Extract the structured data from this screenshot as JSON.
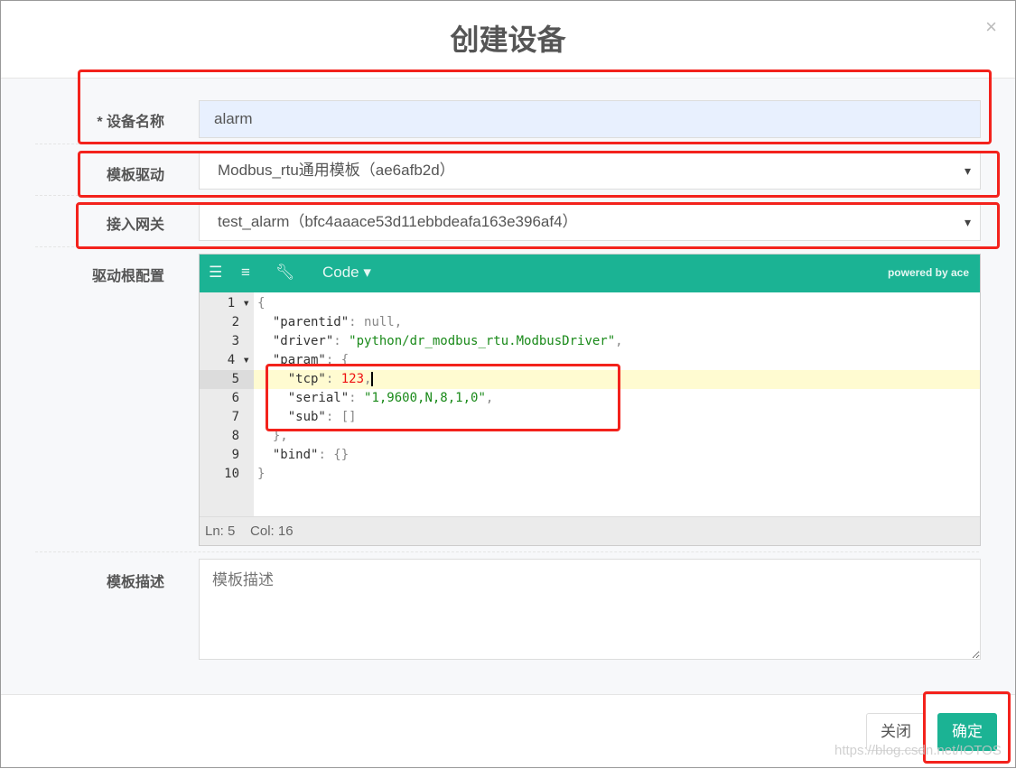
{
  "dialog": {
    "title": "创建设备",
    "close_icon": "×"
  },
  "form": {
    "name": {
      "label": "* 设备名称",
      "value": "alarm"
    },
    "template": {
      "label": "模板驱动",
      "value": "Modbus_rtu通用模板（ae6afb2d）"
    },
    "gateway": {
      "label": "接入网关",
      "value": "test_alarm（bfc4aaace53d11ebbdeafa163e396af4）"
    },
    "config": {
      "label": "驱动根配置"
    },
    "description": {
      "label": "模板描述",
      "placeholder": "模板描述"
    }
  },
  "editor": {
    "mode": "Code",
    "powered": "powered by ace",
    "status": {
      "line": "Ln: 5",
      "col": "Col: 16"
    },
    "line_numbers": [
      "1",
      "2",
      "3",
      "4",
      "5",
      "6",
      "7",
      "8",
      "9",
      "10"
    ],
    "active_line": 5,
    "lines": {
      "l1": "{",
      "l2k": "  \"parentid\"",
      "l2v": "null",
      "l3k": "  \"driver\"",
      "l3v": "\"python/dr_modbus_rtu.ModbusDriver\"",
      "l4k": "  \"param\"",
      "l4v": "{",
      "l5k": "    \"tcp\"",
      "l5v": "123",
      "l6k": "    \"serial\"",
      "l6v": "\"1,9600,N,8,1,0\"",
      "l7k": "    \"sub\"",
      "l7v": "[]",
      "l8": "  },",
      "l9k": "  \"bind\"",
      "l9v": "{}",
      "l10": "}"
    }
  },
  "footer": {
    "close": "关闭",
    "confirm": "确定"
  },
  "watermark": "https://blog.csdn.net/IOTOS",
  "colors": {
    "accent": "#1bb394",
    "highlight": "#f3221c"
  }
}
